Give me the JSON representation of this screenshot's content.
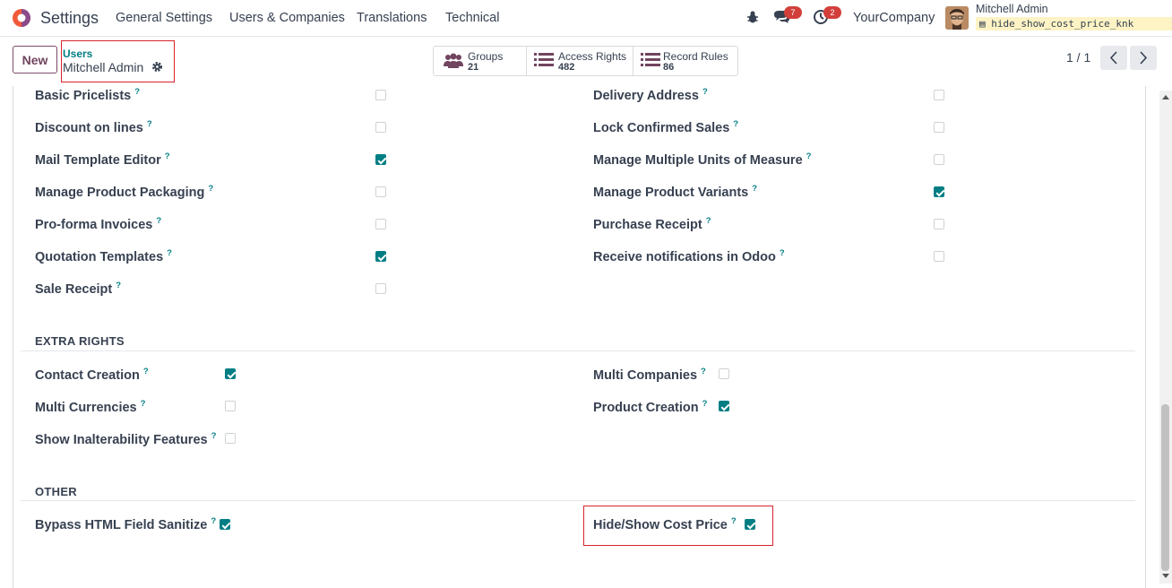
{
  "app": {
    "title": "Settings"
  },
  "menu": [
    {
      "label": "General Settings"
    },
    {
      "label": "Users & Companies"
    },
    {
      "label": "Translations"
    },
    {
      "label": "Technical"
    }
  ],
  "systray": {
    "messages_count": "7",
    "activities_count": "2",
    "company": "YourCompany",
    "user_name": "Mitchell Admin",
    "database": "hide_show_cost_price_knk"
  },
  "control_panel": {
    "new_label": "New",
    "breadcrumb_parent": "Users",
    "breadcrumb_current": "Mitchell Admin",
    "smart_buttons": [
      {
        "label": "Groups",
        "value": "21",
        "icon": "users-icon"
      },
      {
        "label": "Access Rights",
        "value": "482",
        "icon": "list-icon"
      },
      {
        "label": "Record Rules",
        "value": "86",
        "icon": "list-icon"
      }
    ],
    "pager": "1 / 1"
  },
  "technical_rows": [
    {
      "left": {
        "label": "Basic Pricelists",
        "checked": false
      },
      "right": {
        "label": "Delivery Address",
        "checked": false
      }
    },
    {
      "left": {
        "label": "Discount on lines",
        "checked": false
      },
      "right": {
        "label": "Lock Confirmed Sales",
        "checked": false
      }
    },
    {
      "left": {
        "label": "Mail Template Editor",
        "checked": true
      },
      "right": {
        "label": "Manage Multiple Units of Measure",
        "checked": false
      }
    },
    {
      "left": {
        "label": "Manage Product Packaging",
        "checked": false
      },
      "right": {
        "label": "Manage Product Variants",
        "checked": true
      }
    },
    {
      "left": {
        "label": "Pro-forma Invoices",
        "checked": false
      },
      "right": {
        "label": "Purchase Receipt",
        "checked": false
      }
    },
    {
      "left": {
        "label": "Quotation Templates",
        "checked": true
      },
      "right": {
        "label": "Receive notifications in Odoo",
        "checked": false
      }
    },
    {
      "left": {
        "label": "Sale Receipt",
        "checked": false
      }
    }
  ],
  "extra_rights": {
    "title": "EXTRA RIGHTS",
    "rows": [
      {
        "left": {
          "label": "Contact Creation",
          "checked": true
        },
        "right": {
          "label": "Multi Companies",
          "checked": false
        }
      },
      {
        "left": {
          "label": "Multi Currencies",
          "checked": false
        },
        "right": {
          "label": "Product Creation",
          "checked": true
        }
      },
      {
        "left": {
          "label": "Show Inalterability Features",
          "checked": false
        }
      }
    ]
  },
  "other": {
    "title": "OTHER",
    "rows": [
      {
        "left": {
          "label": "Bypass HTML Field Sanitize",
          "checked": true
        },
        "right": {
          "label": "Hide/Show Cost Price",
          "checked": true
        }
      }
    ]
  },
  "help_marker": "?",
  "colors": {
    "accent": "#017e84",
    "brand": "#71455f",
    "highlight": "#d9232d",
    "badge": "#d23f3a"
  }
}
